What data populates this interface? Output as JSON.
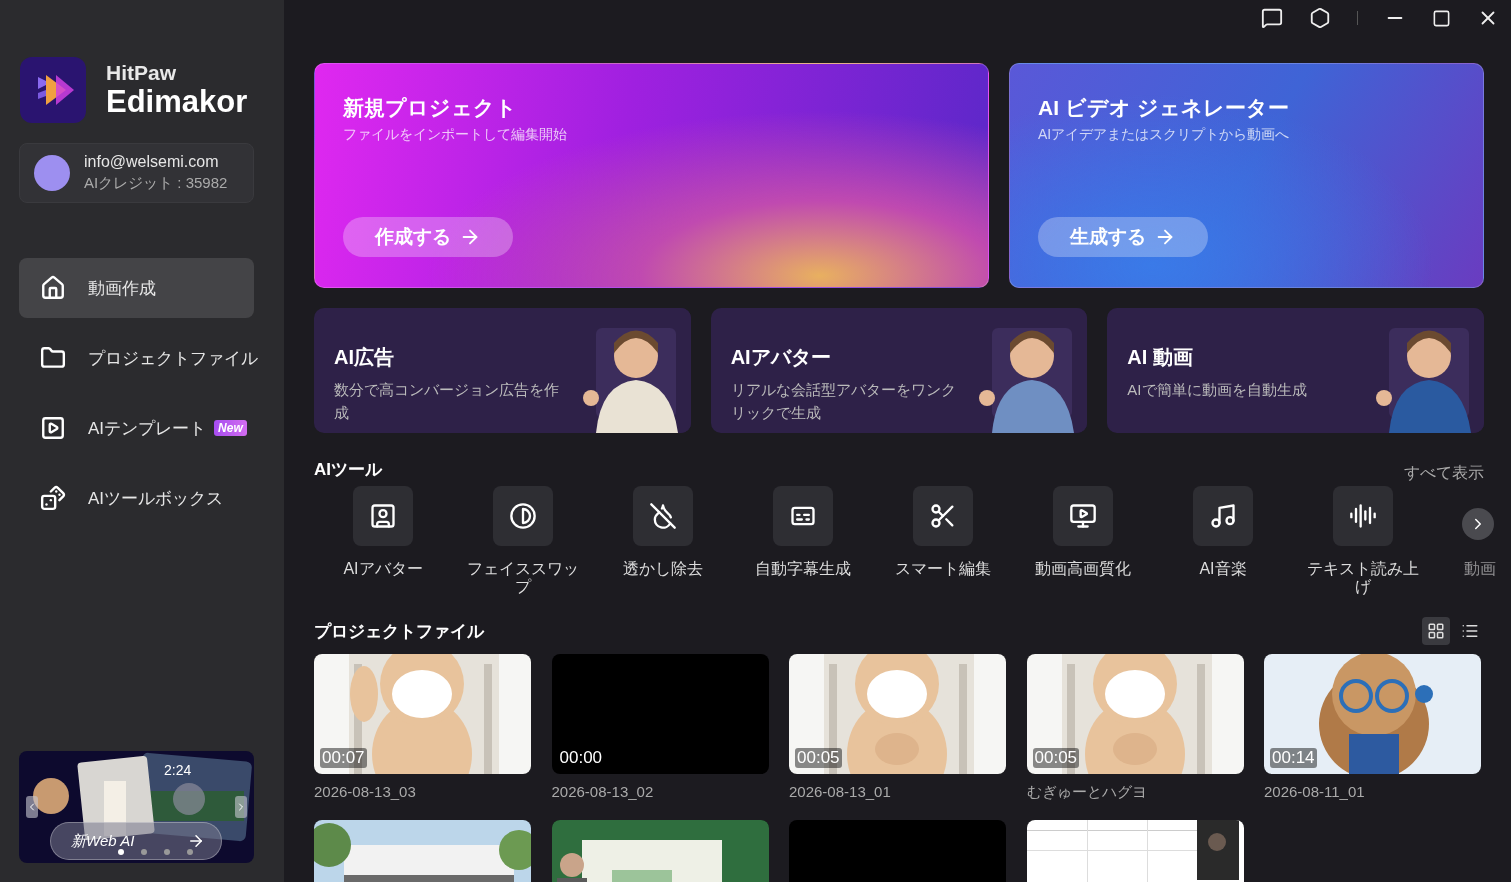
{
  "app": {
    "brand": "HitPaw",
    "product": "Edimakor"
  },
  "account": {
    "email": "info@welsemi.com",
    "credits": "AIクレジット : 35982"
  },
  "nav": [
    {
      "label": "動画作成",
      "selected": true
    },
    {
      "label": "プロジェクトファイル",
      "selected": false
    },
    {
      "label": "AIテンプレート",
      "selected": false,
      "badge": "New"
    },
    {
      "label": "AIツールボックス",
      "selected": false
    }
  ],
  "promo": {
    "time": "2:24",
    "button": "新Web AI",
    "dots": [
      {
        "selected": true
      },
      {
        "selected": false
      },
      {
        "selected": false
      },
      {
        "selected": false
      }
    ]
  },
  "hero_cards": [
    {
      "title": "新規プロジェクト",
      "subtitle": "ファイルをインポートして編集開始",
      "button": "作成する"
    },
    {
      "title": "AI ビデオ ジェネレーター",
      "subtitle": "AIアイデアまたはスクリプトから動画へ",
      "button": "生成する"
    }
  ],
  "feature_cards": [
    {
      "title": "AI広告",
      "description": "数分で高コンバージョン広告を作成"
    },
    {
      "title": "AIアバター",
      "description": "リアルな会話型アバターをワンクリックで生成"
    },
    {
      "title": "AI 動画",
      "description": "AIで簡単に動画を自動生成"
    }
  ],
  "ai_tools": {
    "title": "AIツール",
    "see_all": "すべて表示",
    "items": [
      {
        "label": "AIアバター"
      },
      {
        "label": "フェイススワップ"
      },
      {
        "label": "透かし除去"
      },
      {
        "label": "自動字幕生成"
      },
      {
        "label": "スマート編集"
      },
      {
        "label": "動画高画質化"
      },
      {
        "label": "AI音楽"
      },
      {
        "label": "テキスト読み上げ"
      },
      {
        "label": "動画"
      }
    ]
  },
  "projects": {
    "title": "プロジェクトファイル",
    "view_modes": [
      {
        "selected": true
      },
      {
        "selected": false
      }
    ],
    "items": [
      {
        "kind": "picture",
        "duration": "00:07",
        "name": "2026-08-13_03"
      },
      {
        "kind": "blank",
        "duration": "00:00",
        "name": "2026-08-13_02"
      },
      {
        "kind": "picture",
        "duration": "00:05",
        "name": "2026-08-13_01"
      },
      {
        "kind": "picture",
        "duration": "00:05",
        "name": "むぎゅーとハグヨ"
      },
      {
        "kind": "picture",
        "duration": "00:14",
        "name": "2026-08-11_01"
      },
      {
        "kind": "picture"
      },
      {
        "kind": "picture"
      },
      {
        "kind": "blank"
      },
      {
        "kind": "picture"
      }
    ]
  }
}
